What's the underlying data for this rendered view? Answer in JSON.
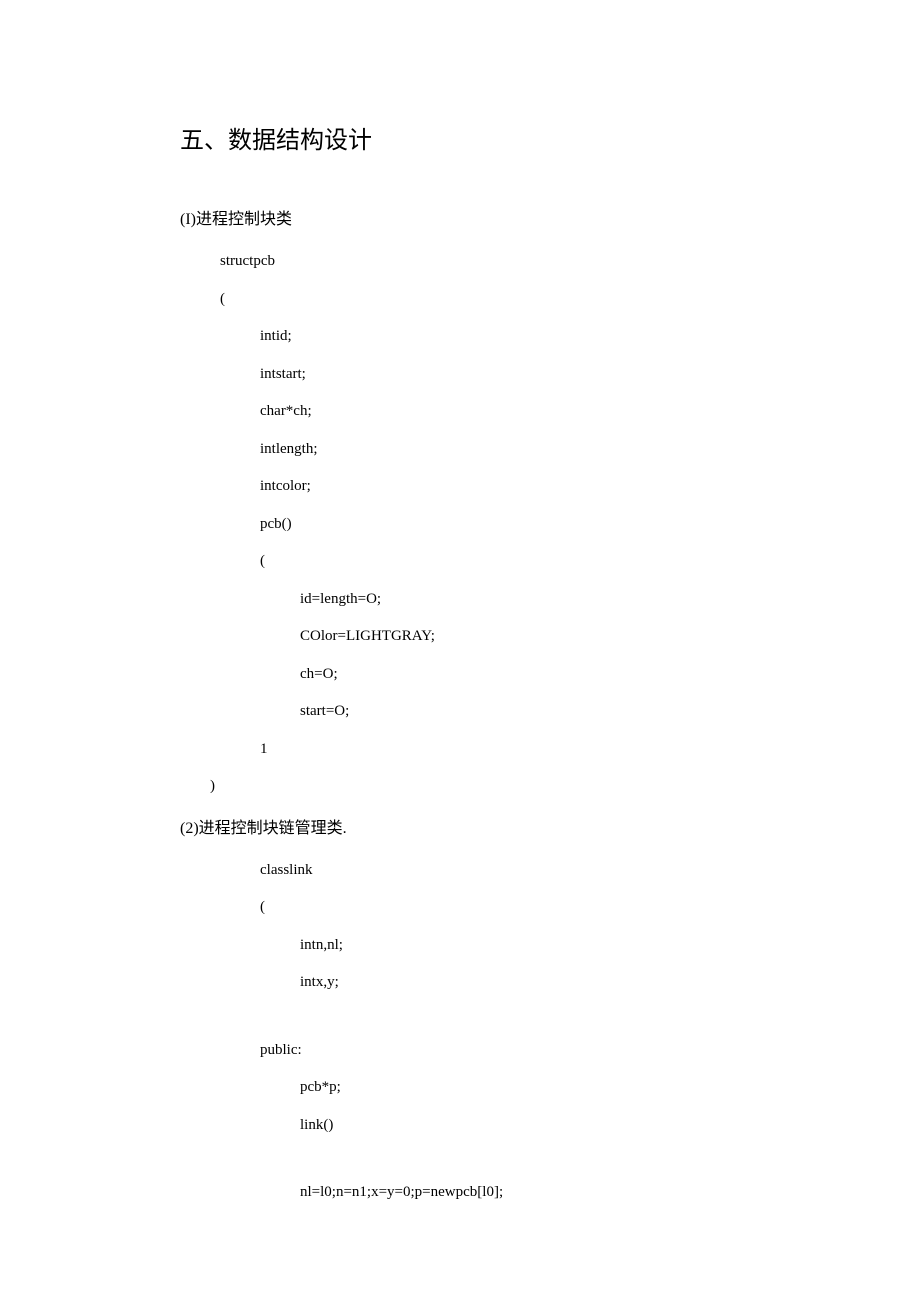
{
  "heading": "五、数据结构设计",
  "section1": {
    "label_paren": "(I)",
    "label_text": "进程控制块类",
    "code": {
      "l1": "structpcb",
      "l2": "(",
      "l3": "intid;",
      "l4": "intstart;",
      "l5": "char*ch;",
      "l6": "intlength;",
      "l7": "intcolor;",
      "l8": "pcb()",
      "l9": "(",
      "l10": "id=length=O;",
      "l11": "COlor=LIGHTGRAY;",
      "l12": "ch=O;",
      "l13": "start=O;",
      "l14": "1",
      "l15": ")"
    }
  },
  "section2": {
    "label_paren": "(2)",
    "label_text": "进程控制块链管理类.",
    "code": {
      "l1": "classlink",
      "l2": "(",
      "l3": "intn,nl;",
      "l4": "intx,y;",
      "l5": "public:",
      "l6": "pcb*p;",
      "l7": "link()",
      "l8": "nl=l0;n=n1;x=y=0;p=newpcb[l0];"
    }
  }
}
